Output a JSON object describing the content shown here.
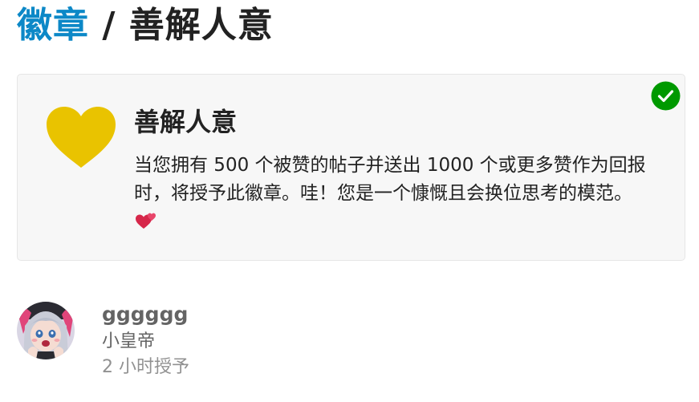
{
  "header": {
    "breadcrumb_link": "徽章",
    "separator": " / ",
    "current": "善解人意"
  },
  "badge": {
    "name": "善解人意",
    "description": "当您拥有 500 个被赞的帖子并送出 1000 个或更多赞作为回报时，将授予此徽章。哇！您是一个慷慨且会换位思考的模范。",
    "icon": "heart-icon",
    "icon_color": "#e9c300",
    "granted_check_icon": "check-circle-icon",
    "granted_check_color": "#009900",
    "trailing_emoji": "two-hearts-icon"
  },
  "grant": {
    "username": "gggggg",
    "user_title": "小皇帝",
    "granted_at": "2 小时授予"
  },
  "colors": {
    "link": "#0c88c7",
    "text": "#222222",
    "muted": "#646464",
    "faint": "#919191",
    "card_bg": "#f7f7f7"
  }
}
